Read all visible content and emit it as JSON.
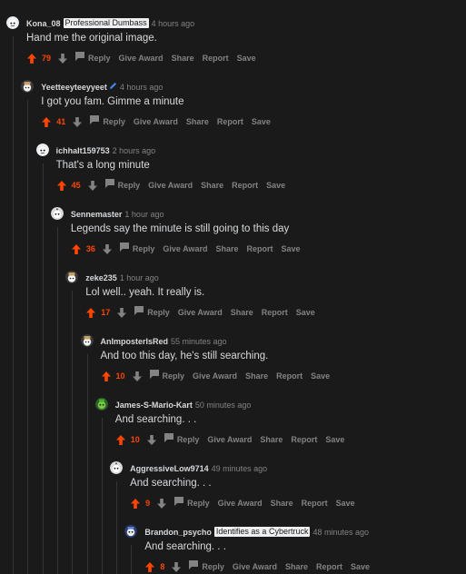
{
  "colors": {
    "background": "#1a1a1b",
    "upvote": "#ff4500",
    "muted": "#818384",
    "text": "#d7dadc",
    "thread_line": "#343536"
  },
  "actions": {
    "reply": "Reply",
    "give_award": "Give Award",
    "share": "Share",
    "report": "Report",
    "save": "Save"
  },
  "comments": [
    {
      "author": "Kona_08",
      "flair": "Professional Dumbass",
      "time": "4 hours ago",
      "body": "Hand me the original image.",
      "score": "79",
      "avatar": "snoo-face-icon"
    },
    {
      "author": "Yeetteeyteeyyeet",
      "time": "4 hours ago",
      "body": "I got you fam. Gimme a minute",
      "score": "41",
      "avatar": "snoo-hat-icon",
      "has_pencil": true
    },
    {
      "author": "ichhalt159753",
      "time": "2 hours ago",
      "body": "That's a long minute",
      "score": "45",
      "avatar": "snoo-face-icon"
    },
    {
      "author": "Sennemaster",
      "time": "1 hour ago",
      "body": "Legends say the minute is still going to this day",
      "score": "36",
      "avatar": "snoo-default-icon"
    },
    {
      "author": "zeke235",
      "time": "1 hour ago",
      "body": "Lol well.. yeah. It really is.",
      "score": "17",
      "avatar": "snoo-hat-icon"
    },
    {
      "author": "AnImposterIsRed",
      "time": "55 minutes ago",
      "body": "And too this day, he's still searching.",
      "score": "10",
      "avatar": "snoo-hat-icon"
    },
    {
      "author": "James-S-Mario-Kart",
      "time": "50 minutes ago",
      "body": "And searching. . .",
      "score": "10",
      "avatar": "snoo-green-icon"
    },
    {
      "author": "AggressiveLow9714",
      "time": "49 minutes ago",
      "body": "And searching. . .",
      "score": "9",
      "avatar": "snoo-default-icon"
    },
    {
      "author": "Brandon_psycho",
      "flair": "Identifies as a Cybertruck",
      "time": "48 minutes ago",
      "body": "And searching. . .",
      "score": "8",
      "avatar": "snoo-blue-icon"
    }
  ]
}
